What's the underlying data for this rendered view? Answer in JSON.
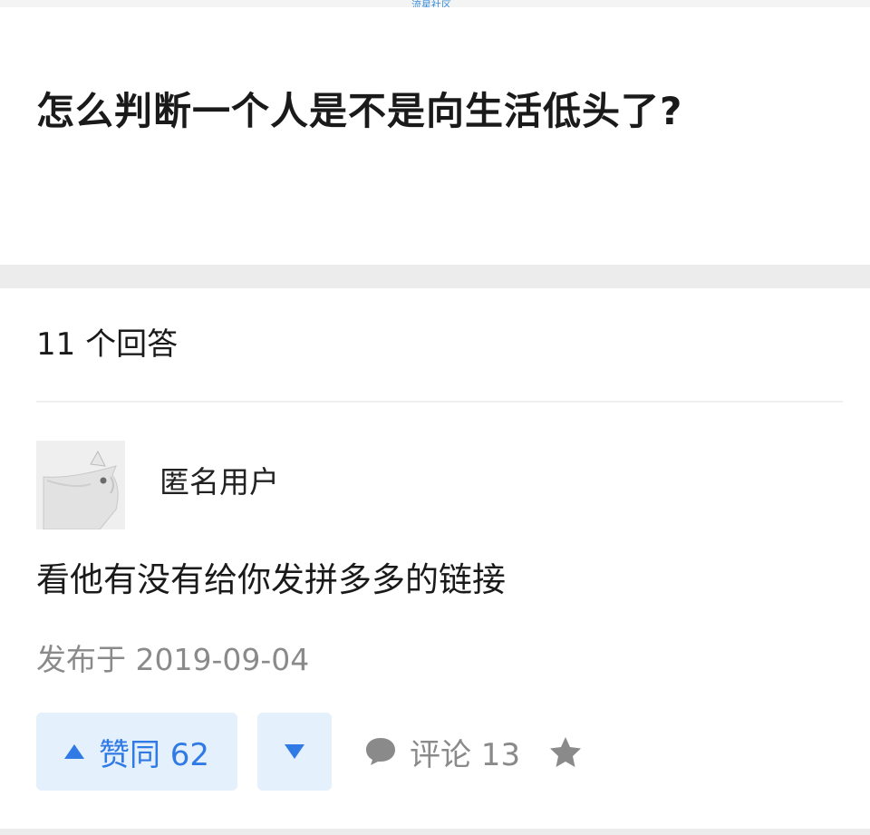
{
  "watermark": "流星社区",
  "question": {
    "title": "怎么判断一个人是不是向生活低头了?"
  },
  "answers": {
    "count_label": "11 个回答",
    "items": [
      {
        "author": "匿名用户",
        "content": "看他有没有给你发拼多多的链接",
        "published": "发布于 2019-09-04",
        "actions": {
          "upvote_label": "赞同 62",
          "comment_label": "评论 13"
        }
      }
    ]
  },
  "icons": {
    "upvote": "triangle-up-icon",
    "downvote": "triangle-down-icon",
    "comment": "speech-bubble-icon",
    "favorite": "star-icon"
  },
  "colors": {
    "accent": "#2f7ae5",
    "button_bg": "#e5f0fd",
    "muted_text": "#8a8a8a"
  }
}
